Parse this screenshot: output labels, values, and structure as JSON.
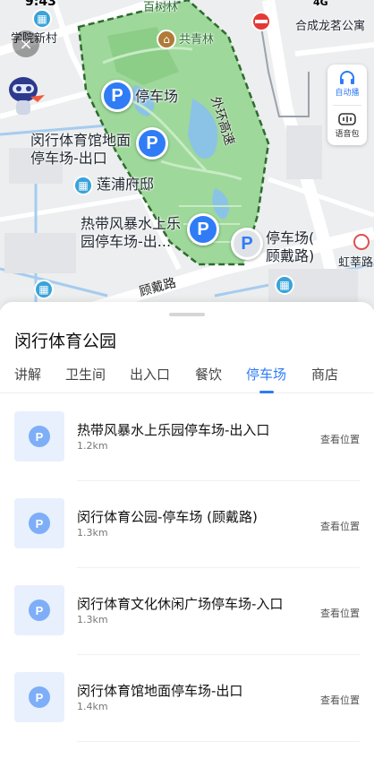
{
  "status": {
    "time": "9:43",
    "signal": "4G"
  },
  "map": {
    "labels": {
      "bai_shu_lin": "百树林",
      "gong_qing_lin": "共青林",
      "he_cheng_long": "合成龙茗公寓",
      "xue_yuan": "学院新村",
      "parking_main": "停车场",
      "gym_parking": "闵行体育馆地面\n停车场-出口",
      "lianpu": "莲浦府邸",
      "tropical": "热带风暴水上乐\n园停车场-出...",
      "parking_gudai": "停车场(\n顾戴路)",
      "hongxin": "虹莘路",
      "outer_ring": "外环高速",
      "gudai_road": "顾戴路"
    },
    "controls": {
      "auto_play": "自动播",
      "voice_pack": "语音包"
    },
    "pin_glyph": "P"
  },
  "sheet": {
    "title": "闵行体育公园",
    "tabs": [
      {
        "label": "讲解"
      },
      {
        "label": "卫生间"
      },
      {
        "label": "出入口"
      },
      {
        "label": "餐饮"
      },
      {
        "label": "停车场"
      },
      {
        "label": "商店"
      }
    ],
    "active_tab": "停车场",
    "items": [
      {
        "name": "热带风暴水上乐园停车场-出入口",
        "distance": "1.2km",
        "action": "查看位置"
      },
      {
        "name": "闵行体育公园-停车场 (顾戴路)",
        "distance": "1.3km",
        "action": "查看位置"
      },
      {
        "name": "闵行体育文化休闲广场停车场-入口",
        "distance": "1.3km",
        "action": "查看位置"
      },
      {
        "name": "闵行体育馆地面停车场-出口",
        "distance": "1.4km",
        "action": "查看位置"
      }
    ]
  },
  "colors": {
    "accent": "#2f7cf6",
    "park": "#9ed89a",
    "park_border": "#2f6b2f"
  }
}
